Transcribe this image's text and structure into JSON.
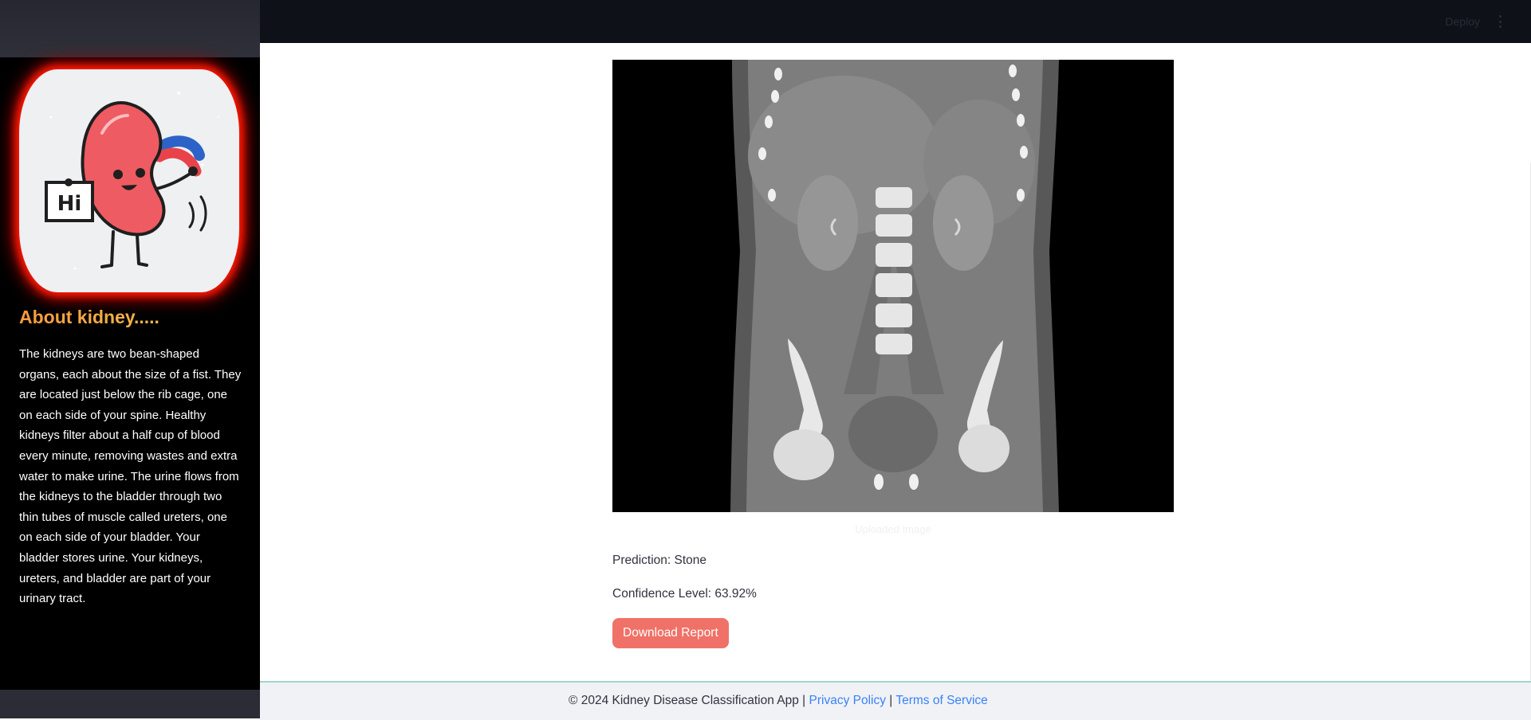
{
  "header": {
    "deploy_label": "Deploy"
  },
  "sidebar": {
    "card_sign_text": "Hi",
    "about_heading": "About kidney.....",
    "about_text": "The kidneys are two bean-shaped organs, each about the size of a fist. They are located just below the rib cage, one on each side of your spine. Healthy kidneys filter about a half cup of blood every minute, removing wastes and extra water to make urine. The urine flows from the kidneys to the bladder through two thin tubes of muscle called ureters, one on each side of your bladder. Your bladder stores urine. Your kidneys, ureters, and bladder are part of your urinary tract."
  },
  "main": {
    "image_caption": "Uploaded Image",
    "prediction_text": "Prediction: Stone",
    "confidence_text": "Confidence Level: 63.92%",
    "download_label": "Download Report"
  },
  "footer": {
    "copyright": "© 2024 Kidney Disease Classification App |",
    "separator": "|",
    "privacy_label": "Privacy Policy",
    "terms_label": "Terms of Service"
  },
  "colors": {
    "accent_button": "#f07167",
    "sidebar_glow": "#ff1a00",
    "heading_gradient": "#ff9a3c",
    "footer_link": "#3b82f6"
  },
  "icons": {
    "kebab": "more-vertical-icon"
  }
}
